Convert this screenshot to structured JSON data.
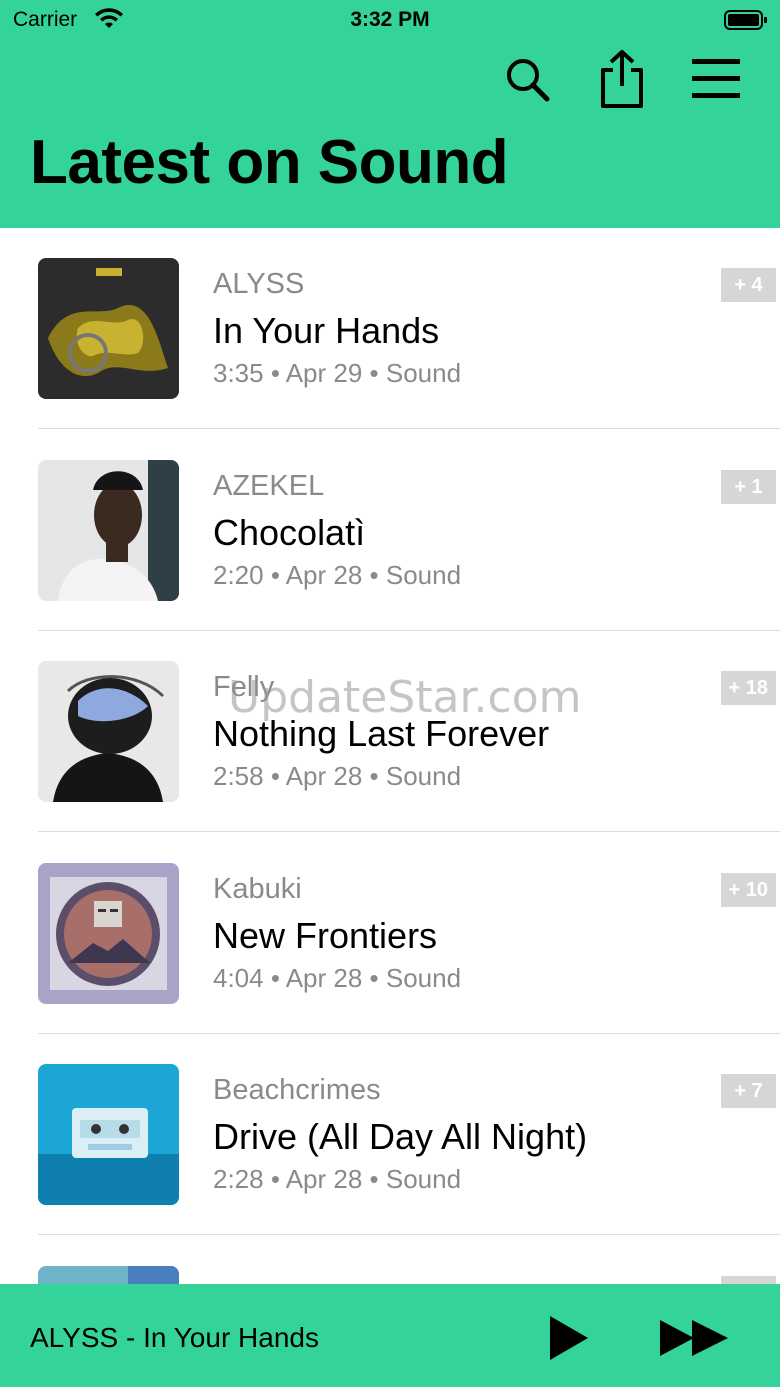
{
  "status_bar": {
    "carrier": "Carrier",
    "time": "3:32 PM"
  },
  "header": {
    "title": "Latest on Sound",
    "icons": [
      "search-icon",
      "share-icon",
      "menu-icon"
    ],
    "background": "#34d399"
  },
  "tracks": [
    {
      "artist": "ALYSS",
      "title": "In Your Hands",
      "meta": "3:35 • Apr 29 • Sound",
      "badge": "+ 4"
    },
    {
      "artist": "AZEKEL",
      "title": "Chocolatì",
      "meta": "2:20 • Apr 28 • Sound",
      "badge": "+ 1"
    },
    {
      "artist": "Felly",
      "title": "Nothing Last Forever",
      "meta": "2:58 • Apr 28 • Sound",
      "badge": "+ 18"
    },
    {
      "artist": "Kabuki",
      "title": "New Frontiers",
      "meta": "4:04 • Apr 28 • Sound",
      "badge": "+ 10"
    },
    {
      "artist": "Beachcrimes",
      "title": "Drive (All Day All Night)",
      "meta": "2:28 • Apr 28 • Sound",
      "badge": "+ 7"
    }
  ],
  "watermark": "UpdateStar.com",
  "player": {
    "now_playing": "ALYSS - In Your Hands",
    "icons": [
      "play-icon",
      "fast-forward-icon"
    ]
  },
  "colors": {
    "accent": "#34d399",
    "badge": "#d6d6d6",
    "secondary_text": "#8a8a8a"
  }
}
